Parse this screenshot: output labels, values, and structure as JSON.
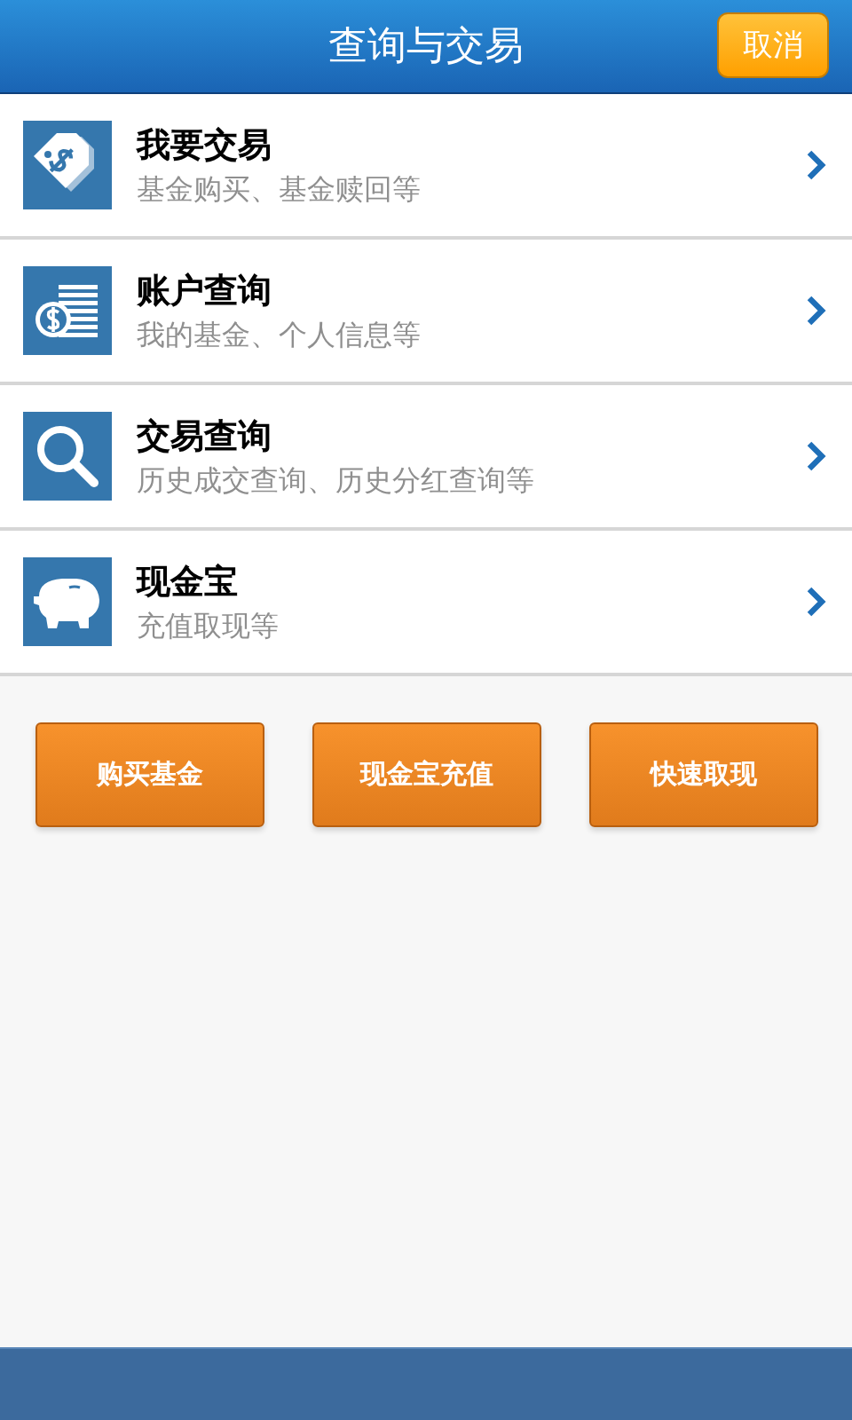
{
  "header": {
    "title": "查询与交易",
    "cancel_button": "取消"
  },
  "menu": [
    {
      "title": "我要交易",
      "subtitle": "基金购买、基金赎回等"
    },
    {
      "title": "账户查询",
      "subtitle": "我的基金、个人信息等"
    },
    {
      "title": "交易查询",
      "subtitle": "历史成交查询、历史分红查询等"
    },
    {
      "title": "现金宝",
      "subtitle": "充值取现等"
    }
  ],
  "actions": [
    "购买基金",
    "现金宝充值",
    "快速取现"
  ]
}
